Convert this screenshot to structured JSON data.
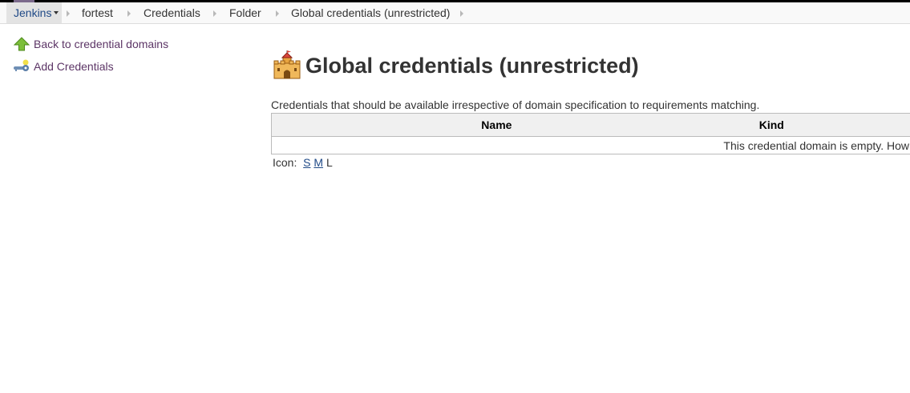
{
  "breadcrumbs": [
    "Jenkins",
    "fortest",
    "Credentials",
    "Folder",
    "Global credentials (unrestricted)"
  ],
  "sidebar": {
    "items": [
      {
        "label": "Back to credential domains",
        "icon": "green-up-arrow-icon"
      },
      {
        "label": "Add Credentials",
        "icon": "key-add-icon"
      }
    ]
  },
  "main": {
    "title": "Global credentials (unrestricted)",
    "title_icon": "castle-icon",
    "description": "Credentials that should be available irrespective of domain specification to requirements matching.",
    "table": {
      "headers": [
        "Name",
        "Kind"
      ],
      "empty_message": "This credential domain is empty. How"
    },
    "icon_size": {
      "label": "Icon:",
      "options": [
        "S",
        "M",
        "L"
      ],
      "current": "L"
    }
  },
  "colors": {
    "link": "#204a87",
    "task_link": "#5c3566",
    "breadcrumb_bg": "#f9f9f9",
    "table_header_bg": "#f0f0f0"
  }
}
